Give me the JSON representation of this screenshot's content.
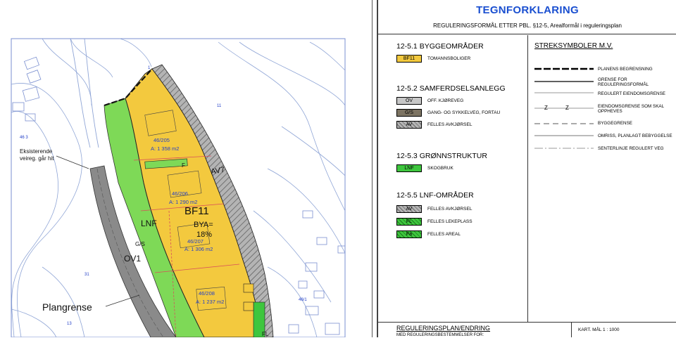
{
  "map": {
    "zone_label": "BF11",
    "bya_label": "BYA=",
    "bya_value": "18%",
    "lnf_label": "LNF",
    "ov_label": "OV1",
    "gs_label": "G/S",
    "av_label": "AV7",
    "f_label": "F",
    "fl_label": "FL",
    "plangrense_label": "Plangrense",
    "existing_road_note_1": "Eksisterende",
    "existing_road_note_2": "veireg. går hit",
    "parcels": [
      {
        "id": "46/205",
        "area": "A: 1 358 m2"
      },
      {
        "id": "46/206",
        "area": "A: 1 290 m2"
      },
      {
        "id": "46/207",
        "area": "A: 1 306 m2"
      },
      {
        "id": "46/208",
        "area": "A: 1 237 m2"
      }
    ],
    "contour_numbers": [
      "46 3",
      "31",
      "13",
      "11",
      "46/1",
      "1"
    ],
    "colors": {
      "residential": "#f3c93e",
      "green": "#7ed957",
      "road": "#8a8a8a",
      "hatch": "#b4b4b4",
      "contour": "#8fa5d6",
      "boundary": "#d94f5a"
    }
  },
  "legend": {
    "title": "TEGNFORKLARING",
    "subtitle": "REGULERINGSFORMÅL ETTER PBL.  §12-5, Arealformål i reguleringsplan",
    "sections": [
      {
        "heading": "12-5.1 BYGGEOMRÅDER",
        "items": [
          {
            "code": "BF11",
            "label": "TOMANNSBOLIGER",
            "color": "#f3c93e",
            "hatch": false
          }
        ]
      },
      {
        "heading": "12-5.2 SAMFERDSELSANLEGG",
        "items": [
          {
            "code": "OV",
            "label": "OFF. KJØREVEG",
            "color": "#c7c7c7",
            "hatch": false
          },
          {
            "code": "G/S",
            "label": "GANG- OG SYKKELVEG, FORTAU",
            "color": "#7d7463",
            "hatch": false
          },
          {
            "code": "AV",
            "label": "FELLES AVKJØRSEL",
            "color": "#b4b4b4",
            "hatch": true
          }
        ]
      },
      {
        "heading": "12-5.3 GRØNNSTRUKTUR",
        "items": [
          {
            "code": "LNF",
            "label": "SKOGBRUK",
            "color": "#3ec63e",
            "hatch": false
          }
        ]
      },
      {
        "heading": "12-5.5 LNF-OMRÅDER",
        "items": [
          {
            "code": "AV",
            "label": "FELLES AVKJØRSEL",
            "color": "#b4b4b4",
            "hatch": true
          },
          {
            "code": "FL",
            "label": "FELLES LEKEPLASS",
            "color": "#3ec63e",
            "hatch": true
          },
          {
            "code": "Fa",
            "label": "FELLES  AREAL",
            "color": "#3ec63e",
            "hatch": true
          }
        ]
      }
    ],
    "symbols_heading": "STREKSYMBOLER M.V.",
    "symbols": [
      {
        "label": "PLANENS BEGRENSNING"
      },
      {
        "label": "GRENSE FOR REGULERINGSFORMÅL"
      },
      {
        "label": "REGULERT EIENDOMSGRENSE"
      },
      {
        "label": "EIENDOMSGRENSE SOM SKAL OPPHEVES",
        "marker": "Z"
      },
      {
        "label": "BYGGEGRENSE"
      },
      {
        "label": "OMRISS, PLANLAGT BEBYGGELSE"
      },
      {
        "label": "SENTERLINJE REGULERT VEG"
      }
    ],
    "bottom": {
      "title": "REGULERINGSPLAN/ENDRING",
      "subtitle": "MED REGULERINGSBESTEMMELSER FOR:",
      "scale_label": "KART.    MÅL 1 : 1000"
    }
  }
}
